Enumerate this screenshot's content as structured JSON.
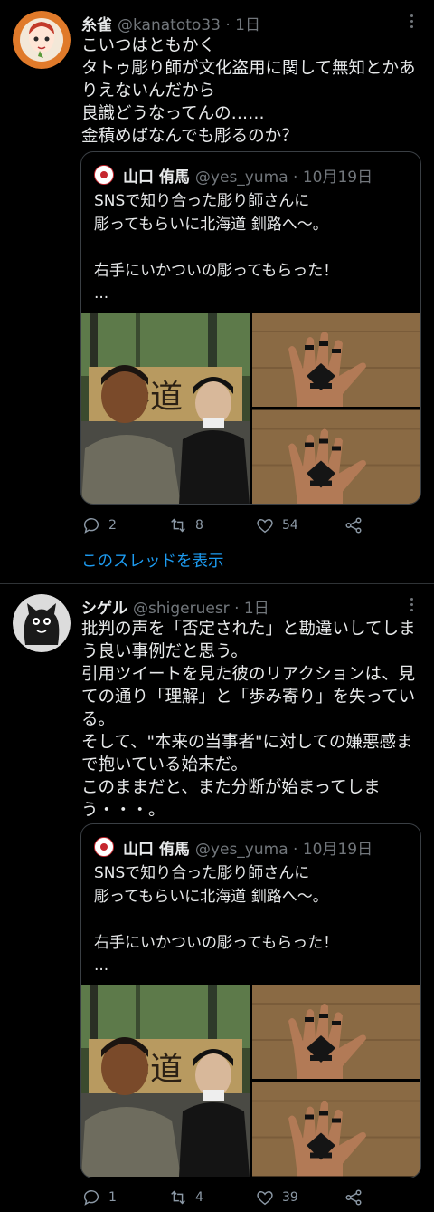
{
  "tweet1": {
    "name": "糸雀",
    "meta": "@kanatoto33 · 1日",
    "text": "こいつはともかく\nタトゥ彫り師が文化盗用に関して無知とかあ\nりえないんだから\n良識どうなってんの……\n金積めばなんでも彫るのか？",
    "quote": {
      "name": "山口 侑馬",
      "meta": "@yes_yuma · 10月19日",
      "text": "SNSで知り合った彫り師さんに\n彫ってもらいに北海道 釧路へ〜。\n\n右手にいかついの彫ってもらった！\n..."
    },
    "actions": {
      "replies": "2",
      "retweets": "8",
      "likes": "54"
    },
    "thread_link": "このスレッドを表示"
  },
  "tweet2": {
    "name": "シゲル",
    "meta": "@shigeruesr · 1日",
    "text": "批判の声を「否定された」と勘違いしてしま\nう良い事例だと思う。\n引用ツイートを見た彼のリアクションは、見\nての通り「理解」と「歩み寄り」を失ってい\nる。\nそして、\"本来の当事者\"に対しての嫌悪感ま\nで抱いている始末だ。\nこのままだと、また分断が始まってしま\nう・・・。",
    "quote": {
      "name": "山口 侑馬",
      "meta": "@yes_yuma · 10月19日",
      "text": "SNSで知り合った彫り師さんに\n彫ってもらいに北海道 釧路へ〜。\n\n右手にいかついの彫ってもらった！\n..."
    },
    "actions": {
      "replies": "1",
      "retweets": "4",
      "likes": "39"
    }
  },
  "icons": [
    "more-icon",
    "reply-icon",
    "retweet-icon",
    "like-icon",
    "share-icon"
  ],
  "colors": {
    "background": "#000000",
    "text": "#e7e9ea",
    "muted": "#71767b",
    "link": "#1d9bf0",
    "border": "#2f3336"
  }
}
